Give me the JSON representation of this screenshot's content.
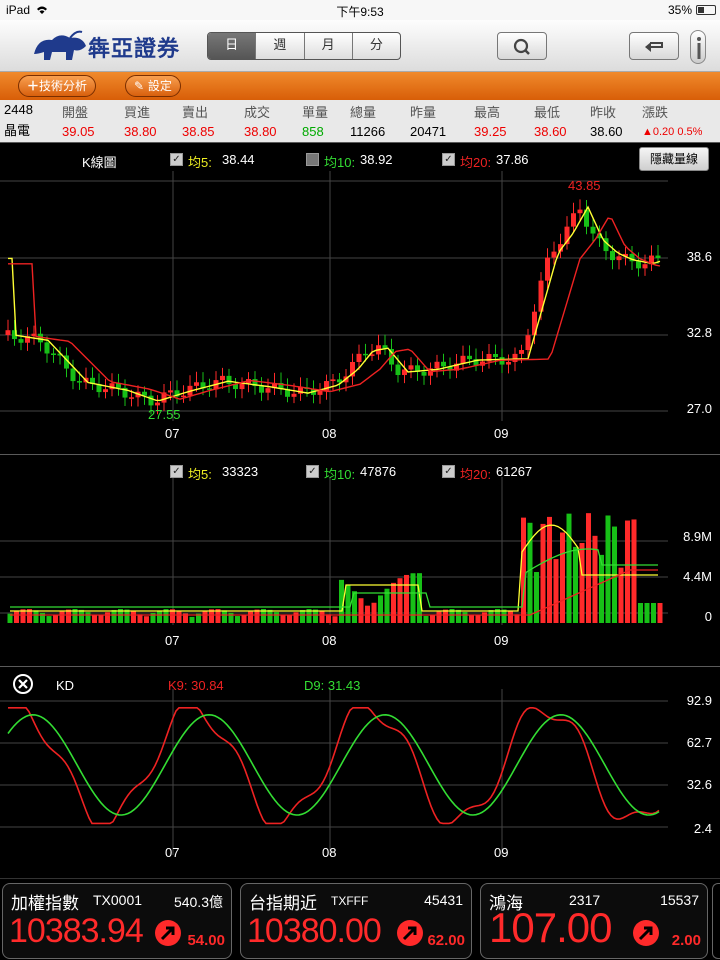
{
  "status": {
    "device": "iPad",
    "time": "下午9:53",
    "battery": "35%"
  },
  "header": {
    "logo_text": "犇亞證券",
    "segments": [
      "日",
      "週",
      "月",
      "分"
    ],
    "active_segment": 0
  },
  "toolbar": {
    "analysis_label": "技術分析",
    "settings_label": "設定"
  },
  "quote": {
    "code": "2448",
    "name": "晶電",
    "cols": [
      {
        "h": "開盤",
        "v": "39.05",
        "c": "#e00"
      },
      {
        "h": "買進",
        "v": "38.80",
        "c": "#e00"
      },
      {
        "h": "賣出",
        "v": "38.85",
        "c": "#e00"
      },
      {
        "h": "成交",
        "v": "38.80",
        "c": "#e00"
      },
      {
        "h": "單量",
        "v": "858",
        "c": "#0a0"
      },
      {
        "h": "總量",
        "v": "11266",
        "c": "#000"
      },
      {
        "h": "昨量",
        "v": "20471",
        "c": "#000"
      },
      {
        "h": "最高",
        "v": "39.25",
        "c": "#e00"
      },
      {
        "h": "最低",
        "v": "38.60",
        "c": "#e00"
      },
      {
        "h": "昨收",
        "v": "38.60",
        "c": "#000"
      },
      {
        "h": "漲跌",
        "v": "▲0.20 0.5%",
        "c": "#e00"
      }
    ]
  },
  "kline": {
    "title": "K線圖",
    "ma5_label": "均5:",
    "ma5": "38.44",
    "ma10_label": "均10:",
    "ma10": "38.92",
    "ma20_label": "均20:",
    "ma20": "37.86",
    "hide_volume_label": "隱藏量線",
    "high_mark": "43.85",
    "low_mark": "27.55",
    "y_ticks": [
      "38.6",
      "32.8",
      "27.0"
    ],
    "x_ticks": [
      "07",
      "08",
      "09"
    ]
  },
  "volume": {
    "ma5_label": "均5:",
    "ma5": "33323",
    "ma10_label": "均10:",
    "ma10": "47876",
    "ma20_label": "均20:",
    "ma20": "61267",
    "y_ticks": [
      "8.9M",
      "4.4M",
      "0"
    ],
    "x_ticks": [
      "07",
      "08",
      "09"
    ]
  },
  "kd": {
    "title": "KD",
    "k_label": "K9: 30.84",
    "d_label": "D9: 31.43",
    "y_ticks": [
      "92.9",
      "62.7",
      "32.6",
      "2.4"
    ],
    "x_ticks": [
      "07",
      "08",
      "09"
    ]
  },
  "cards": [
    {
      "name": "加權指數",
      "code": "TX0001",
      "vol": "540.3億",
      "price": "10383.94",
      "chg": "54.00"
    },
    {
      "name": "台指期近",
      "code": "TXFFF",
      "vol": "45431",
      "price": "10380.00",
      "chg": "62.00"
    },
    {
      "name": "鴻海",
      "code": "2317",
      "vol": "15537",
      "price": "107.00",
      "chg": "2.00"
    }
  ],
  "colors": {
    "up": "#ff2a2a",
    "down": "#17c017",
    "ma5": "#ffff33",
    "ma10": "#33dd33",
    "ma20": "#ee2222"
  }
}
